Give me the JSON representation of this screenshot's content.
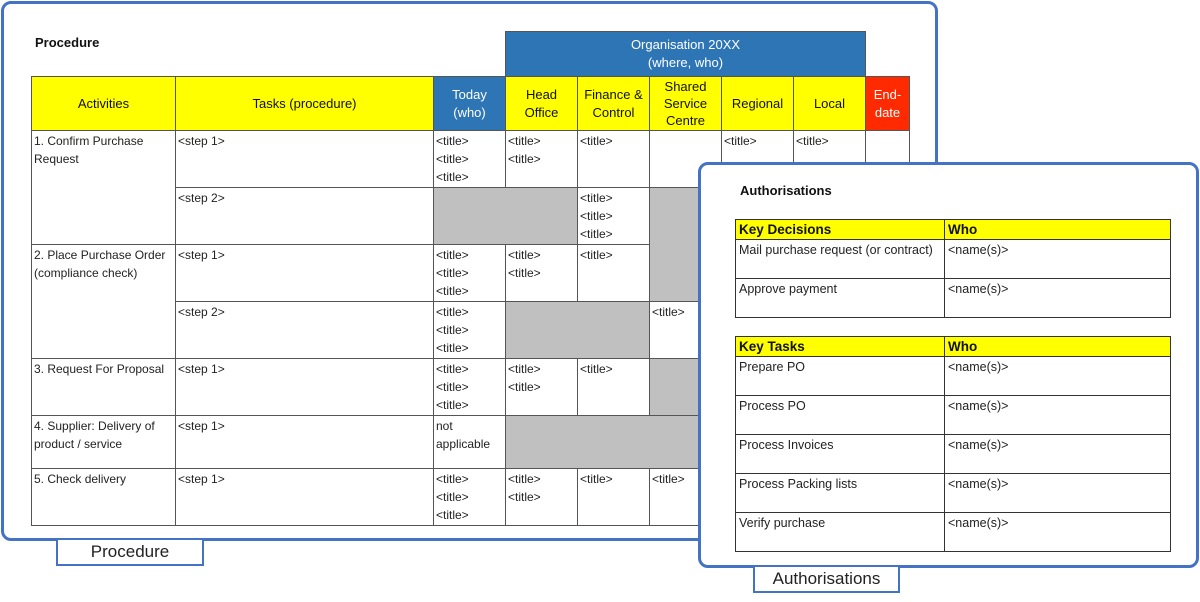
{
  "procedure": {
    "title": "Procedure",
    "caption": "Procedure",
    "org_header": "Organisation 20XX\n(where, who)",
    "columns": {
      "activities": "Activities",
      "tasks": "Tasks (procedure)",
      "today": "Today\n(who)",
      "head_office": "Head\nOffice",
      "finance": "Finance &\nControl",
      "shared": "Shared\nService\nCentre",
      "regional": "Regional",
      "local": "Local",
      "end_date": "End-\ndate"
    },
    "activities": [
      "1. Confirm Purchase Request",
      "2. Place Purchase Order (compliance check)",
      "3. Request For Proposal",
      "4. Supplier: Delivery of product / service",
      "5. Check delivery"
    ],
    "steps": {
      "step1": "<step 1>",
      "step2": "<step 2>"
    },
    "cells": {
      "title": "<title>",
      "not_applicable": "not\napplicable"
    }
  },
  "authorisations": {
    "title": "Authorisations",
    "caption": "Authorisations",
    "decisions": {
      "header_left": "Key Decisions",
      "header_right": "Who",
      "rows": [
        {
          "item": "Mail purchase request (or contract)",
          "who": "<name(s)>"
        },
        {
          "item": "Approve payment",
          "who": "<name(s)>"
        }
      ]
    },
    "tasks": {
      "header_left": "Key Tasks",
      "header_right": "Who",
      "rows": [
        {
          "item": "Prepare PO",
          "who": "<name(s)>"
        },
        {
          "item": "Process PO",
          "who": "<name(s)>"
        },
        {
          "item": "Process Invoices",
          "who": "<name(s)>"
        },
        {
          "item": "Process Packing lists",
          "who": "<name(s)>"
        },
        {
          "item": "Verify purchase",
          "who": "<name(s)>"
        }
      ]
    }
  },
  "colors": {
    "border": "#4472c4",
    "yellow": "#ffff00",
    "blue_header": "#2e75b6",
    "red_header": "#ff2a00",
    "gray_fill": "#c0c0c0"
  }
}
